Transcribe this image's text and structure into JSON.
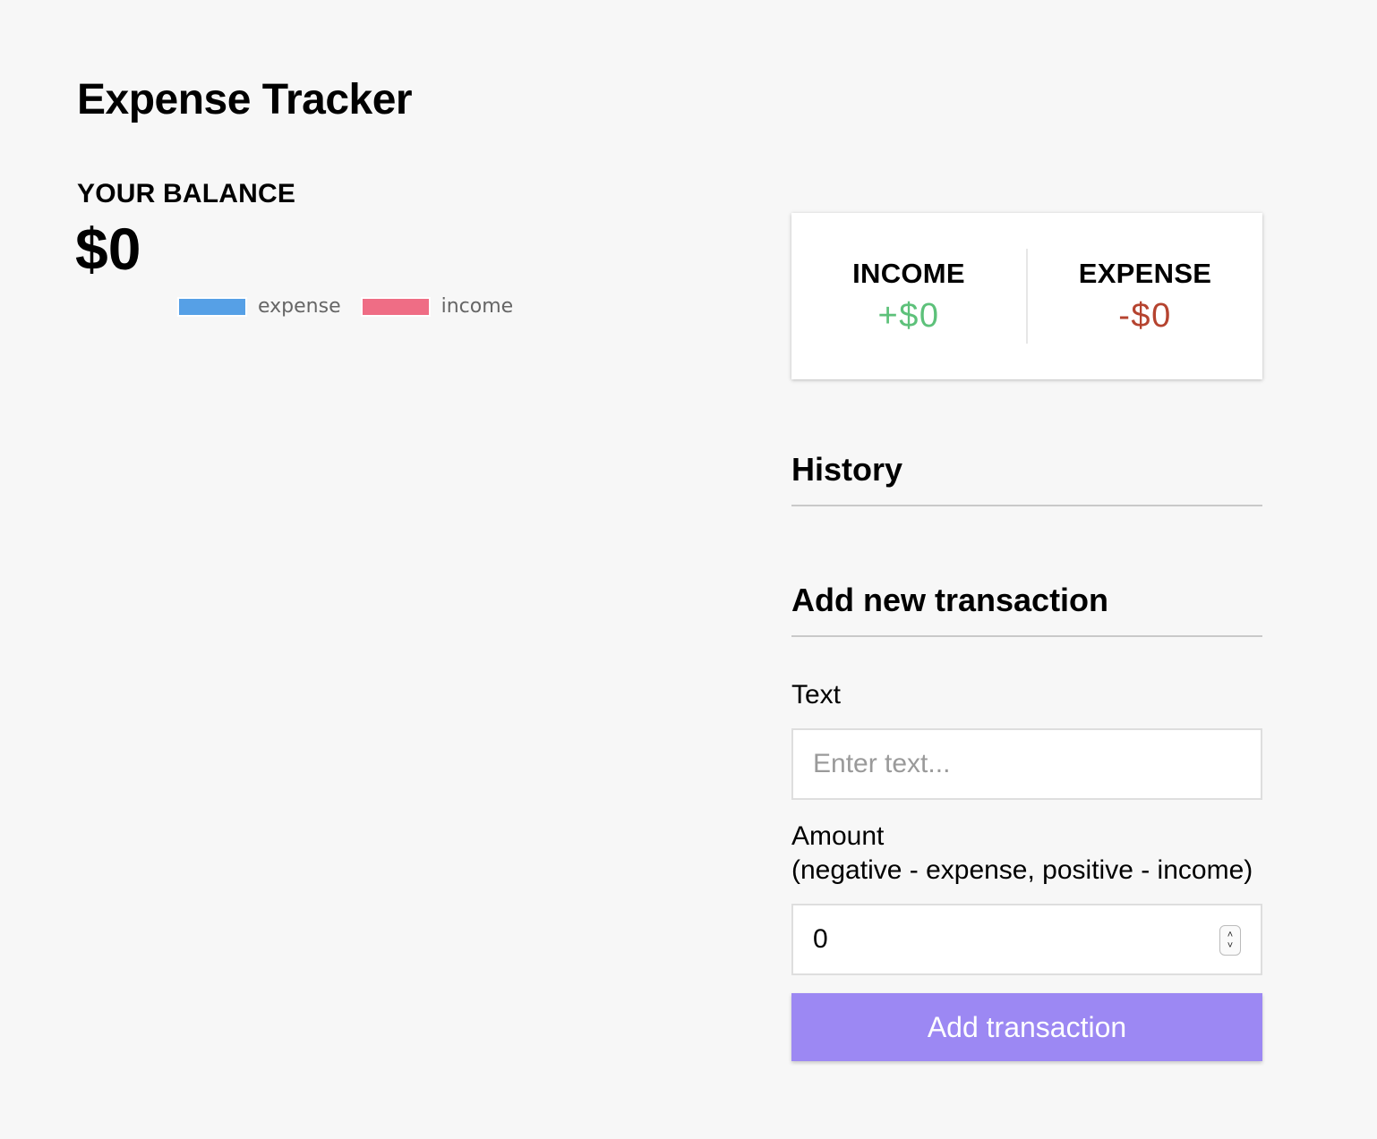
{
  "app": {
    "title": "Expense Tracker"
  },
  "balance": {
    "label": "YOUR BALANCE",
    "value": "$0"
  },
  "legend": {
    "items": [
      {
        "label": "expense",
        "color": "#56a0e6"
      },
      {
        "label": "income",
        "color": "#ef6d85"
      }
    ]
  },
  "summary": {
    "income": {
      "label": "INCOME",
      "value": "+$0",
      "color": "#5dc17a"
    },
    "expense": {
      "label": "EXPENSE",
      "value": "-$0",
      "color": "#b5432f"
    }
  },
  "history": {
    "heading": "History",
    "items": []
  },
  "form": {
    "heading": "Add new transaction",
    "text_label": "Text",
    "text_placeholder": "Enter text...",
    "text_value": "",
    "amount_label_line1": "Amount",
    "amount_label_line2": "(negative - expense, positive - income)",
    "amount_value": "0",
    "submit_label": "Add transaction",
    "submit_color": "#9c88f3"
  }
}
